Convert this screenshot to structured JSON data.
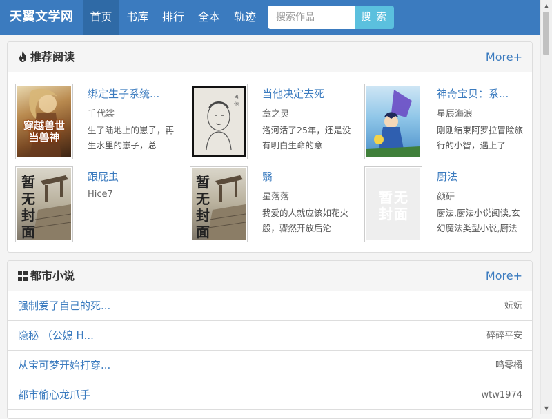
{
  "nav": {
    "brand": "天翼文学网",
    "items": [
      {
        "label": "首页",
        "active": true
      },
      {
        "label": "书库",
        "active": false
      },
      {
        "label": "排行",
        "active": false
      },
      {
        "label": "全本",
        "active": false
      },
      {
        "label": "轨迹",
        "active": false
      }
    ],
    "search_placeholder": "搜索作品",
    "search_button": "搜 索"
  },
  "recommend": {
    "title": "推荐阅读",
    "more": "More+",
    "icon": "fire-icon",
    "books": [
      {
        "title": "绑定生子系统...",
        "author": "千代裟",
        "desc": "生了陆地上的崽子，再生水里的崽子，总",
        "cover": "art",
        "cover_text": "穿越兽世当兽神"
      },
      {
        "title": "当他决定去死",
        "author": "章之灵",
        "desc": "洛河活了25年，还是没有明白生命的意",
        "cover": "sketch",
        "cover_text": ""
      },
      {
        "title": "神奇宝贝：系...",
        "author": "星辰海浪",
        "desc": "刚刚结束阿罗拉冒险旅行的小智，遇上了",
        "cover": "anime",
        "cover_text": ""
      },
      {
        "title": "跟屁虫",
        "author": "Hice7",
        "desc": "",
        "cover": "placeholder",
        "cover_text": "暂无封面"
      },
      {
        "title": "翳",
        "author": "星落落",
        "desc": "我爱的人就应该如花火般，骤然开放后沦",
        "cover": "placeholder",
        "cover_text": "暂无封面"
      },
      {
        "title": "厨法",
        "author": "颜研",
        "desc": "厨法,厨法小说阅读,玄幻魔法类型小说,厨法",
        "cover": "blank",
        "cover_text": "暂无封面"
      }
    ]
  },
  "urban": {
    "title": "都市小说",
    "more": "More+",
    "icon": "grid-icon",
    "items": [
      {
        "title": "强制爱了自己的死...",
        "author": "妧妧"
      },
      {
        "title": "隐秘 （公媳 H...",
        "author": "碎碎平安"
      },
      {
        "title": "从宝可梦开始打穿...",
        "author": "鸣零橘"
      },
      {
        "title": "都市偷心龙爪手",
        "author": "wtw1974"
      }
    ]
  }
}
